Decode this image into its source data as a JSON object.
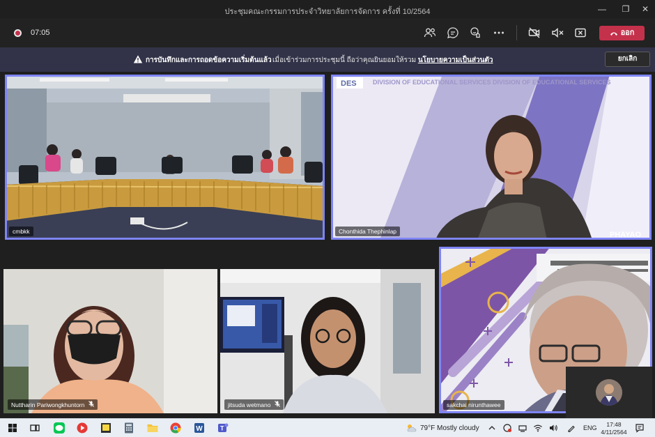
{
  "window": {
    "title": "ประชุมคณะกรรมการประจำวิทยาลัยการจัดการ ครั้งที่ 10/2564",
    "minimize_glyph": "—",
    "maximize_glyph": "❐",
    "close_glyph": "✕"
  },
  "toolbar": {
    "elapsed": "07:05",
    "leave_label": "ออก",
    "icons": [
      "participants-icon",
      "chat-icon",
      "reactions-icon",
      "more-options-icon",
      "camera-off-icon",
      "mic-muted-icon",
      "share-tray-icon"
    ]
  },
  "notice": {
    "bold_text": "การบันทึกและการถอดข้อความเริ่มต้นแล้ว",
    "text": "เมื่อเข้าร่วมการประชุมนี้ ถือว่าคุณยินยอมให้รวม",
    "link_text": "นโยบายความเป็นส่วนตัว",
    "cancel_label": "ยกเลิก"
  },
  "participants": [
    {
      "name": "cmbkk",
      "muted": false,
      "speaking": true
    },
    {
      "name": "Chonthida Thephinlap",
      "muted": false,
      "speaking": true,
      "background_text": "DIVISION OF EDUCATIONAL SERVICES  DIVISION OF EDUCATIONAL SERVICES",
      "logo": "DES",
      "corner_text": "PHAYAO"
    },
    {
      "name": "Nuttharin Pariwongkhuntorn",
      "muted": true,
      "speaking": false
    },
    {
      "name": "jitsuda wetmano",
      "muted": true,
      "speaking": false
    },
    {
      "name": "sakchai nirunthawee",
      "muted": false,
      "speaking": true
    }
  ],
  "taskbar": {
    "weather_temp": "79°F",
    "weather_desc": "Mostly cloudy",
    "language": "ENG",
    "time": "17:48",
    "date": "4/11/2564"
  },
  "colors": {
    "accent": "#7f85f5",
    "leave": "#c4314b",
    "notice_bg": "#323348"
  }
}
